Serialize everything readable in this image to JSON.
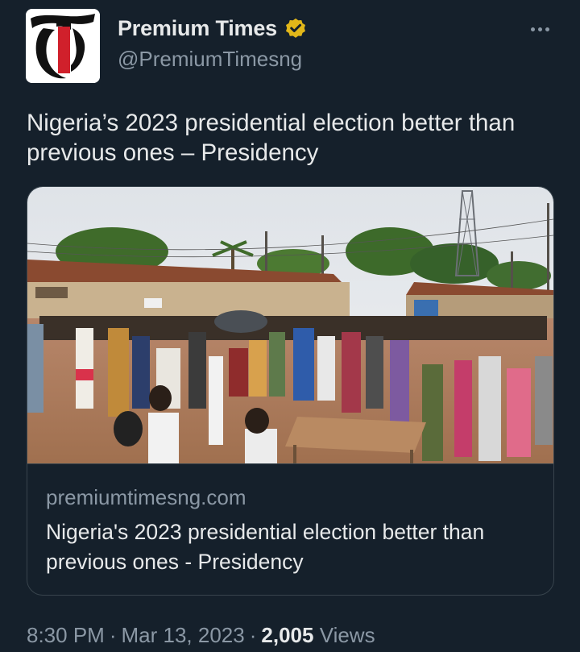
{
  "author": {
    "display_name": "Premium Times",
    "handle": "@PremiumTimesng",
    "avatar_letter": "T",
    "verified_color": "#e2b719"
  },
  "tweet": {
    "text": "Nigeria’s 2023 presidential election better than previous ones – Presidency"
  },
  "card": {
    "domain": "premiumtimesng.com",
    "title": "Nigeria's 2023 presidential election better than previous ones - Presidency"
  },
  "meta": {
    "time": "8:30 PM",
    "separator": "·",
    "date": "Mar 13, 2023",
    "views_count": "2,005",
    "views_label": "Views"
  },
  "icons": {
    "more": "more-horizontal-icon",
    "verified": "verified-badge-icon"
  },
  "colors": {
    "background": "#15202b",
    "primary_text": "#e7e9ea",
    "secondary_text": "#8b98a5",
    "border": "#38444d",
    "logo_red": "#d0202b"
  }
}
